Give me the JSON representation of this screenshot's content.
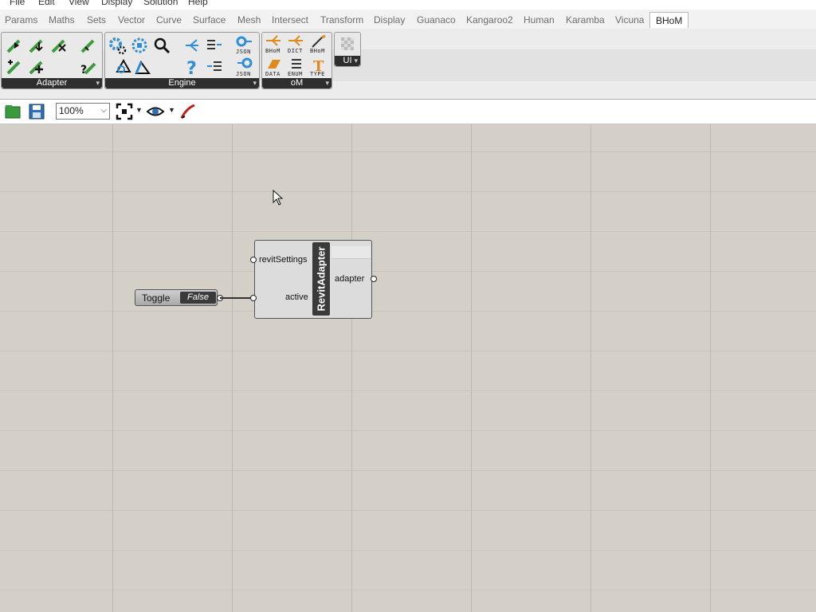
{
  "menu": [
    "File",
    "Edit",
    "View",
    "Display",
    "Solution",
    "Help"
  ],
  "tabs": [
    "Params",
    "Maths",
    "Sets",
    "Vector",
    "Curve",
    "Surface",
    "Mesh",
    "Intersect",
    "Transform",
    "Display",
    "Guanaco",
    "Kangaroo2",
    "Human",
    "Karamba",
    "Vicuna",
    "BHoM"
  ],
  "active_tab": "BHoM",
  "panels": {
    "adapter": {
      "label": "Adapter",
      "icons": [
        "push-icon",
        "pull-icon",
        "remove-icon",
        "execute-icon",
        "move-icon",
        "create-adapter-icon",
        "query-icon"
      ]
    },
    "engine": {
      "label": "Engine",
      "icons": [
        "settings-icon",
        "compute-icon",
        "search-icon",
        "explode-icon",
        "list-icon",
        "to-json-icon",
        "geometry-icon",
        "vector-icon",
        "help-icon",
        "list-2-icon",
        "from-json-icon"
      ]
    },
    "om": {
      "label": "oM",
      "icons": [
        "bhom-icon",
        "dict-icon",
        "bhom-wand-icon",
        "data-icon",
        "enum-icon",
        "type-icon"
      ],
      "captions": {
        "json_top": "JSON",
        "json_bottom": "JSON",
        "bhom": "BHoM",
        "dict": "DICT",
        "bhom2": "BHoM",
        "data": "DATA",
        "enum": "ENUM",
        "type": "TYPE"
      }
    },
    "ui": {
      "label": "UI"
    }
  },
  "toolbar": {
    "zoom": "100%"
  },
  "canvas": {
    "toggle": {
      "label": "Toggle",
      "value": "False"
    },
    "component": {
      "name": "RevitAdapter",
      "inputs": [
        "revitSettings",
        "active"
      ],
      "outputs": [
        "adapter"
      ]
    }
  },
  "colors": {
    "accent_green": "#3b9a3b",
    "accent_orange": "#e08a1e",
    "accent_blue": "#2f8ed8",
    "canvas": "#d4d0c8"
  }
}
